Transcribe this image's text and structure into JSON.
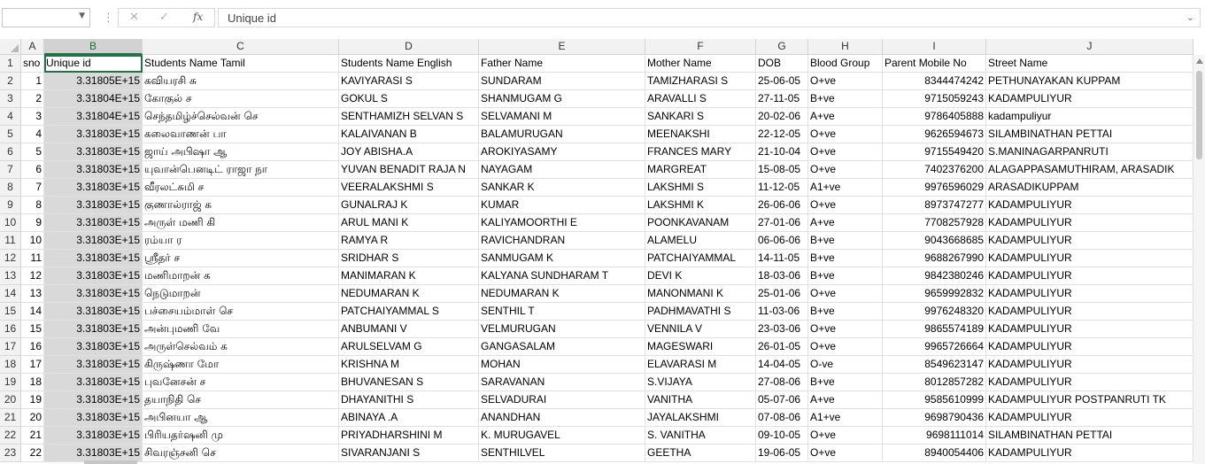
{
  "formula_bar": {
    "name_box_value": "",
    "cancel_icon": "✕",
    "enter_icon": "✓",
    "fx_label": "fx",
    "formula_value": "Unique id"
  },
  "columns": [
    {
      "letter": "A"
    },
    {
      "letter": "B"
    },
    {
      "letter": "C"
    },
    {
      "letter": "D"
    },
    {
      "letter": "E"
    },
    {
      "letter": "F"
    },
    {
      "letter": "G"
    },
    {
      "letter": "H"
    },
    {
      "letter": "I"
    },
    {
      "letter": "J"
    }
  ],
  "selected_column": "B",
  "header_row": [
    "sno",
    "Unique id",
    "Students Name Tamil",
    "Students Name English",
    "Father Name",
    "Mother Name",
    "DOB",
    "Blood Group",
    "Parent Mobile No",
    "Street Name"
  ],
  "rows": [
    [
      "1",
      "3.31805E+15",
      "கவியரசி சு",
      "KAVIYARASI S",
      "SUNDARAM",
      "TAMIZHARASI S",
      "25-06-05",
      "O+ve",
      "8344474242",
      "PETHUNAYAKAN KUPPAM"
    ],
    [
      "2",
      "3.31804E+15",
      "கோகுல் ச",
      "GOKUL S",
      "SHANMUGAM G",
      "ARAVALLI S",
      "27-11-05",
      "B+ve",
      "9715059243",
      "KADAMPULIYUR"
    ],
    [
      "3",
      "3.31804E+15",
      "செந்தமிழ்ச்செல்வன் செ",
      "SENTHAMIZH SELVAN S",
      "SELVAMANI M",
      "SANKARI S",
      "20-02-06",
      "A+ve",
      "9786405888",
      "kadampuliyur"
    ],
    [
      "4",
      "3.31803E+15",
      "கலைவாணன் பா",
      "KALAIVANAN B",
      "BALAMURUGAN",
      "MEENAKSHI",
      "22-12-05",
      "O+ve",
      "9626594673",
      "SILAMBINATHAN PETTAI"
    ],
    [
      "5",
      "3.31803E+15",
      "ஜாய் அபிஷா ஆ",
      "JOY ABISHA.A",
      "AROKIYASAMY",
      "FRANCES MARY",
      "21-10-04",
      "O+ve",
      "9715549420",
      "S.MANINAGARPANRUTI"
    ],
    [
      "6",
      "3.31803E+15",
      "யுவான்பெனடிட் ராஜா நா",
      "YUVAN BENADIT RAJA N",
      "NAYAGAM",
      "MARGREAT",
      "15-08-05",
      "O+ve",
      "7402376200",
      "ALAGAPPASAMUTHIRAM, ARASADIK"
    ],
    [
      "7",
      "3.31803E+15",
      "வீரலட்சுமி ச",
      "VEERALAKSHMI S",
      "SANKAR K",
      "LAKSHMI S",
      "11-12-05",
      "A1+ve",
      "9976596029",
      "ARASADIKUPPAM"
    ],
    [
      "8",
      "3.31803E+15",
      "குணால்ராஜ் க",
      "GUNALRAJ K",
      "KUMAR",
      "LAKSHMI K",
      "26-06-06",
      "O+ve",
      "8973747277",
      "KADAMPULIYUR"
    ],
    [
      "9",
      "3.31803E+15",
      "அருள் மணி கி",
      "ARUL MANI K",
      "KALIYAMOORTHI E",
      "POONKAVANAM",
      "27-01-06",
      "A+ve",
      "7708257928",
      "KADAMPULIYUR"
    ],
    [
      "10",
      "3.31803E+15",
      "ரம்யா ர",
      "RAMYA R",
      "RAVICHANDRAN",
      "ALAMELU",
      "06-06-06",
      "B+ve",
      "9043668685",
      "KADAMPULIYUR"
    ],
    [
      "11",
      "3.31803E+15",
      "ஸ்ரீதர் ச",
      "SRIDHAR S",
      "SANMUGAM K",
      "PATCHAIYAMMAL",
      "14-11-05",
      "B+ve",
      "9688267990",
      "KADAMPULIYUR"
    ],
    [
      "12",
      "3.31803E+15",
      "மணிமாறன் க",
      "MANIMARAN K",
      "KALYANA SUNDHARAM T",
      "DEVI K",
      "18-03-06",
      "B+ve",
      "9842380246",
      "KADAMPULIYUR"
    ],
    [
      "13",
      "3.31803E+15",
      "நெடுமாறன்",
      "NEDUMARAN K",
      "NEDUMARAN K",
      "MANONMANI K",
      "25-01-06",
      "O+ve",
      "9659992832",
      "KADAMPULIYUR"
    ],
    [
      "14",
      "3.31803E+15",
      "பச்சையம்மாள் செ",
      "PATCHAIYAMMAL S",
      "SENTHIL T",
      "PADHMAVATHI S",
      "11-03-06",
      "B+ve",
      "9976248320",
      "KADAMPULIYUR"
    ],
    [
      "15",
      "3.31803E+15",
      "அன்புமணி வே",
      "ANBUMANI V",
      "VELMURUGAN",
      "VENNILA V",
      "23-03-06",
      "O+ve",
      "9865574189",
      "KADAMPULIYUR"
    ],
    [
      "16",
      "3.31803E+15",
      "அருள்செல்வம் க",
      "ARULSELVAM G",
      "GANGASALAM",
      "MAGESWARI",
      "26-01-05",
      "O+ve",
      "9965726664",
      "KADAMPULIYUR"
    ],
    [
      "17",
      "3.31803E+15",
      "கிருஷ்ணா மோ",
      "KRISHNA M",
      "MOHAN",
      "ELAVARASI M",
      "14-04-05",
      "O-ve",
      "8549623147",
      "KADAMPULIYUR"
    ],
    [
      "18",
      "3.31803E+15",
      "புவனேசன் ச",
      "BHUVANESAN S",
      "SARAVANAN",
      "S.VIJAYA",
      "27-08-06",
      "B+ve",
      "8012857282",
      "KADAMPULIYUR"
    ],
    [
      "19",
      "3.31803E+15",
      "தயாநிதி செ",
      "DHAYANITHI S",
      "SELVADURAI",
      "VANITHA",
      "05-07-06",
      "A+ve",
      "9585610999",
      "KADAMPULIYUR POSTPANRUTI TK"
    ],
    [
      "20",
      "3.31803E+15",
      "அபினயா ஆ",
      "ABINAYA .A",
      "ANANDHAN",
      "JAYALAKSHMI",
      "07-08-06",
      "A1+ve",
      "9698790436",
      "KADAMPULIYUR"
    ],
    [
      "21",
      "3.31803E+15",
      "பிரியதர்ஷனி மு",
      "PRIYADHARSHINI M",
      "K. MURUGAVEL",
      "S. VANITHA",
      "09-10-05",
      "O+ve",
      "9698111014",
      "SILAMBINATHAN  PETTAI"
    ],
    [
      "22",
      "3.31803E+15",
      "சிவரஞ்சனி செ",
      "SIVARANJANI S",
      "SENTHILVEL",
      "GEETHA",
      "19-06-05",
      "O+ve",
      "8940054406",
      "KADAMPULIYUR"
    ]
  ]
}
